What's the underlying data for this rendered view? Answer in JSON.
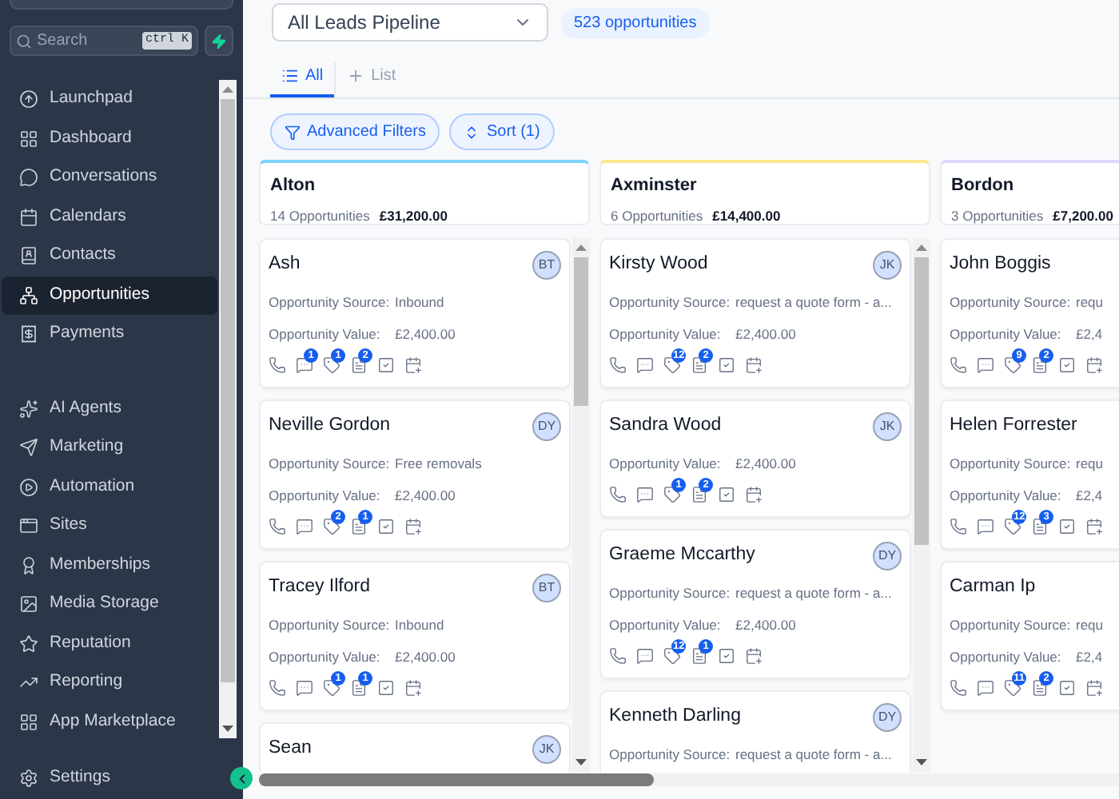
{
  "sidebar": {
    "search": {
      "placeholder": "Search",
      "shortcut": "ctrl K"
    },
    "nav_groups": [
      [
        {
          "label": "Launchpad",
          "selected": false
        },
        {
          "label": "Dashboard",
          "selected": false
        },
        {
          "label": "Conversations",
          "selected": false
        },
        {
          "label": "Calendars",
          "selected": false
        },
        {
          "label": "Contacts",
          "selected": false
        },
        {
          "label": "Opportunities",
          "selected": true
        },
        {
          "label": "Payments",
          "selected": false
        }
      ],
      [
        {
          "label": "AI Agents",
          "selected": false
        },
        {
          "label": "Marketing",
          "selected": false
        },
        {
          "label": "Automation",
          "selected": false
        },
        {
          "label": "Sites",
          "selected": false
        },
        {
          "label": "Memberships",
          "selected": false
        },
        {
          "label": "Media Storage",
          "selected": false
        },
        {
          "label": "Reputation",
          "selected": false
        },
        {
          "label": "Reporting",
          "selected": false
        },
        {
          "label": "App Marketplace",
          "selected": false
        }
      ]
    ],
    "footer_item": {
      "label": "Settings"
    }
  },
  "toolbar": {
    "pipeline": "All Leads Pipeline",
    "count": "523 opportunities"
  },
  "tabs": [
    {
      "label": "All",
      "kind": "list",
      "selected": true
    },
    {
      "label": "List",
      "kind": "add",
      "selected": false
    }
  ],
  "filters": [
    {
      "label": "Advanced Filters",
      "kind": "filter"
    },
    {
      "label": "Sort (1)",
      "kind": "sort"
    }
  ],
  "columns": [
    {
      "name": "Alton",
      "count": "14 Opportunities",
      "total": "£31,200.00",
      "color": "#7dd3fc",
      "cards": [
        {
          "name": "Ash",
          "avatar": "BT",
          "fields": [
            {
              "label": "Opportunity Source:",
              "value": "Inbound"
            },
            {
              "label": "Opportunity Value:",
              "value": "£2,400.00"
            }
          ],
          "actions": [
            {
              "kind": "phone"
            },
            {
              "kind": "chat",
              "badge": "1"
            },
            {
              "kind": "tag",
              "badge": "1"
            },
            {
              "kind": "note",
              "badge": "2"
            },
            {
              "kind": "task"
            },
            {
              "kind": "calendar"
            }
          ]
        },
        {
          "name": "Neville Gordon",
          "avatar": "DY",
          "fields": [
            {
              "label": "Opportunity Source:",
              "value": "Free removals"
            },
            {
              "label": "Opportunity Value:",
              "value": "£2,400.00"
            }
          ],
          "actions": [
            {
              "kind": "phone"
            },
            {
              "kind": "chat"
            },
            {
              "kind": "tag",
              "badge": "2"
            },
            {
              "kind": "note",
              "badge": "1"
            },
            {
              "kind": "task"
            },
            {
              "kind": "calendar"
            }
          ]
        },
        {
          "name": "Tracey Ilford",
          "avatar": "BT",
          "fields": [
            {
              "label": "Opportunity Source:",
              "value": "Inbound"
            },
            {
              "label": "Opportunity Value:",
              "value": "£2,400.00"
            }
          ],
          "actions": [
            {
              "kind": "phone"
            },
            {
              "kind": "chat"
            },
            {
              "kind": "tag",
              "badge": "1"
            },
            {
              "kind": "note",
              "badge": "1"
            },
            {
              "kind": "task"
            },
            {
              "kind": "calendar"
            }
          ]
        },
        {
          "name": "Sean",
          "avatar": "JK"
        }
      ]
    },
    {
      "name": "Axminster",
      "count": "6 Opportunities",
      "total": "£14,400.00",
      "color": "#fde68a",
      "cards": [
        {
          "name": "Kirsty Wood",
          "avatar": "JK",
          "fields": [
            {
              "label": "Opportunity Source:",
              "value": "request a quote form - a..."
            },
            {
              "label": "Opportunity Value:",
              "value": "£2,400.00"
            }
          ],
          "actions": [
            {
              "kind": "phone"
            },
            {
              "kind": "chat"
            },
            {
              "kind": "tag",
              "badge": "12"
            },
            {
              "kind": "note",
              "badge": "2"
            },
            {
              "kind": "task"
            },
            {
              "kind": "calendar"
            }
          ]
        },
        {
          "name": "Sandra Wood",
          "avatar": "JK",
          "fields": [
            {
              "label": "Opportunity Value:",
              "value": "£2,400.00"
            }
          ],
          "actions": [
            {
              "kind": "phone"
            },
            {
              "kind": "chat"
            },
            {
              "kind": "tag",
              "badge": "1"
            },
            {
              "kind": "note",
              "badge": "2"
            },
            {
              "kind": "task"
            },
            {
              "kind": "calendar"
            }
          ]
        },
        {
          "name": "Graeme Mccarthy",
          "avatar": "DY",
          "fields": [
            {
              "label": "Opportunity Source:",
              "value": "request a quote form - a..."
            },
            {
              "label": "Opportunity Value:",
              "value": "£2,400.00"
            }
          ],
          "actions": [
            {
              "kind": "phone"
            },
            {
              "kind": "chat"
            },
            {
              "kind": "tag",
              "badge": "12"
            },
            {
              "kind": "note",
              "badge": "1"
            },
            {
              "kind": "task"
            },
            {
              "kind": "calendar"
            }
          ]
        },
        {
          "name": "Kenneth Darling",
          "avatar": "DY",
          "fields": [
            {
              "label": "Opportunity Source:",
              "value": "request a quote form - a..."
            }
          ]
        }
      ]
    },
    {
      "name": "Bordon",
      "count": "3 Opportunities",
      "total": "£7,200.00",
      "color": "#ddd6fe",
      "cards": [
        {
          "name": "John Boggis",
          "fields": [
            {
              "label": "Opportunity Source:",
              "value": "requ"
            },
            {
              "label": "Opportunity Value:",
              "value": "£2,4"
            }
          ],
          "actions": [
            {
              "kind": "phone"
            },
            {
              "kind": "chat"
            },
            {
              "kind": "tag",
              "badge": "9"
            },
            {
              "kind": "note",
              "badge": "2"
            },
            {
              "kind": "task"
            },
            {
              "kind": "calendar"
            }
          ]
        },
        {
          "name": "Helen Forrester",
          "fields": [
            {
              "label": "Opportunity Source:",
              "value": "requ"
            },
            {
              "label": "Opportunity Value:",
              "value": "£2,4"
            }
          ],
          "actions": [
            {
              "kind": "phone"
            },
            {
              "kind": "chat"
            },
            {
              "kind": "tag",
              "badge": "12"
            },
            {
              "kind": "note",
              "badge": "3"
            },
            {
              "kind": "task"
            },
            {
              "kind": "calendar"
            }
          ]
        },
        {
          "name": "Carman Ip",
          "fields": [
            {
              "label": "Opportunity Source:",
              "value": "requ"
            },
            {
              "label": "Opportunity Value:",
              "value": "£2,4"
            }
          ],
          "actions": [
            {
              "kind": "phone"
            },
            {
              "kind": "chat"
            },
            {
              "kind": "tag",
              "badge": "11"
            },
            {
              "kind": "note",
              "badge": "2"
            },
            {
              "kind": "task"
            },
            {
              "kind": "calendar"
            }
          ]
        }
      ]
    }
  ]
}
